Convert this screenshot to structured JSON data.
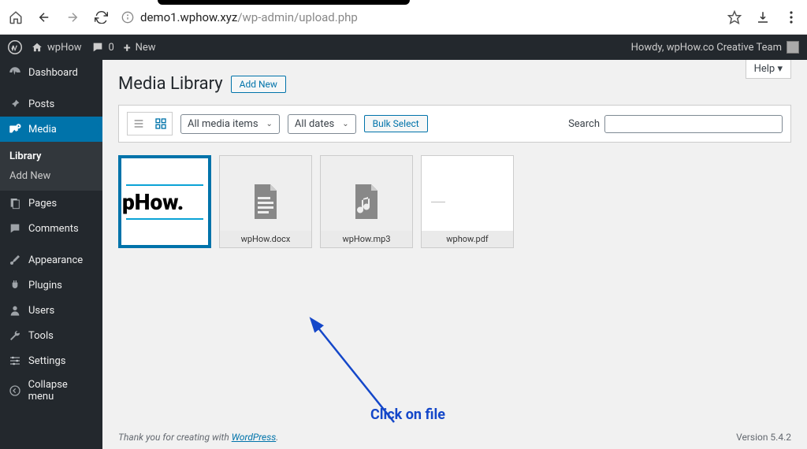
{
  "browser": {
    "host": "demo1.wphow.xyz",
    "path": "/wp-admin/upload.php"
  },
  "admin_bar": {
    "site_name": "wpHow",
    "comments_count": "0",
    "new_label": "New",
    "howdy_prefix": "Howdy, ",
    "user_name": "wpHow.co Creative Team"
  },
  "sidebar": {
    "items": [
      {
        "id": "dashboard",
        "label": "Dashboard"
      },
      {
        "id": "posts",
        "label": "Posts"
      },
      {
        "id": "media",
        "label": "Media",
        "current": true,
        "sub": [
          {
            "id": "library",
            "label": "Library",
            "current": true
          },
          {
            "id": "add-new",
            "label": "Add New"
          }
        ]
      },
      {
        "id": "pages",
        "label": "Pages"
      },
      {
        "id": "comments",
        "label": "Comments"
      },
      {
        "id": "appearance",
        "label": "Appearance"
      },
      {
        "id": "plugins",
        "label": "Plugins"
      },
      {
        "id": "users",
        "label": "Users"
      },
      {
        "id": "tools",
        "label": "Tools"
      },
      {
        "id": "settings",
        "label": "Settings"
      },
      {
        "id": "collapse",
        "label": "Collapse menu"
      }
    ]
  },
  "main": {
    "help_label": "Help",
    "title": "Media Library",
    "add_new_label": "Add New",
    "filter_media": "All media items",
    "filter_dates": "All dates",
    "bulk_select_label": "Bulk Select",
    "search_label": "Search",
    "search_value": ""
  },
  "media": {
    "items": [
      {
        "id": "img-phow",
        "type": "image",
        "caption": "",
        "selected": true
      },
      {
        "id": "docx",
        "type": "document",
        "caption": "wpHow.docx"
      },
      {
        "id": "mp3",
        "type": "audio",
        "caption": "wpHow.mp3"
      },
      {
        "id": "pdf",
        "type": "pdf",
        "caption": "wphow.pdf"
      }
    ]
  },
  "annotation": {
    "text": "Click on file"
  },
  "footer": {
    "thanks": "Thank you for creating with ",
    "wp": "WordPress",
    "version": "Version 5.4.2"
  }
}
